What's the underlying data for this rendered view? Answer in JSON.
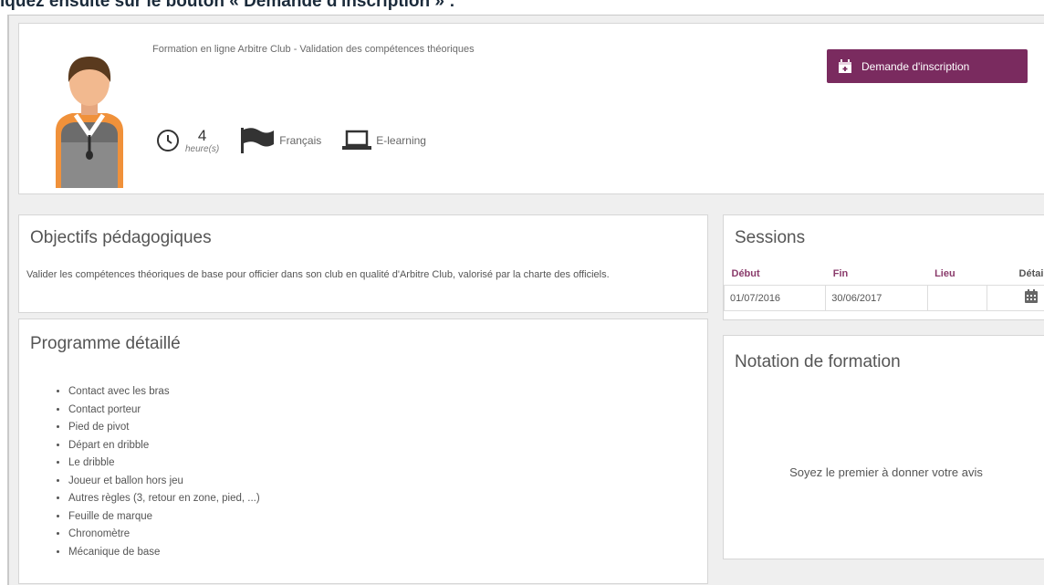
{
  "caption": "iquez ensuite sur le bouton « Demande d'inscription » :",
  "course": {
    "title": "Formation en ligne Arbitre Club - Validation des compétences théoriques",
    "duration_value": "4",
    "duration_unit": "heure(s)",
    "language": "Français",
    "mode": "E-learning"
  },
  "enroll_button": {
    "label": "Demande d'inscription",
    "icon": "calendar-plus-icon",
    "color": "#7a2b5f"
  },
  "objectives": {
    "title": "Objectifs pédagogiques",
    "text": "Valider les compétences théoriques de base pour officier dans son club en qualité d'Arbitre Club, valorisé par la charte des officiels."
  },
  "program": {
    "title": "Programme détaillé",
    "items": [
      "Contact avec les bras",
      "Contact porteur",
      "Pied de pivot",
      "Départ en dribble",
      "Le dribble",
      "Joueur et ballon hors jeu",
      "Autres règles (3, retour en zone, pied, ...)",
      "Feuille de marque",
      "Chronomètre",
      "Mécanique de base"
    ]
  },
  "sessions": {
    "title": "Sessions",
    "headers": {
      "start": "Début",
      "end": "Fin",
      "place": "Lieu",
      "detail": "Détail"
    },
    "rows": [
      {
        "start": "01/07/2016",
        "end": "30/06/2017",
        "place": "",
        "detail_icon": "calendar-icon"
      }
    ]
  },
  "rating": {
    "title": "Notation de formation",
    "empty_text": "Soyez le premier à donner votre avis"
  }
}
